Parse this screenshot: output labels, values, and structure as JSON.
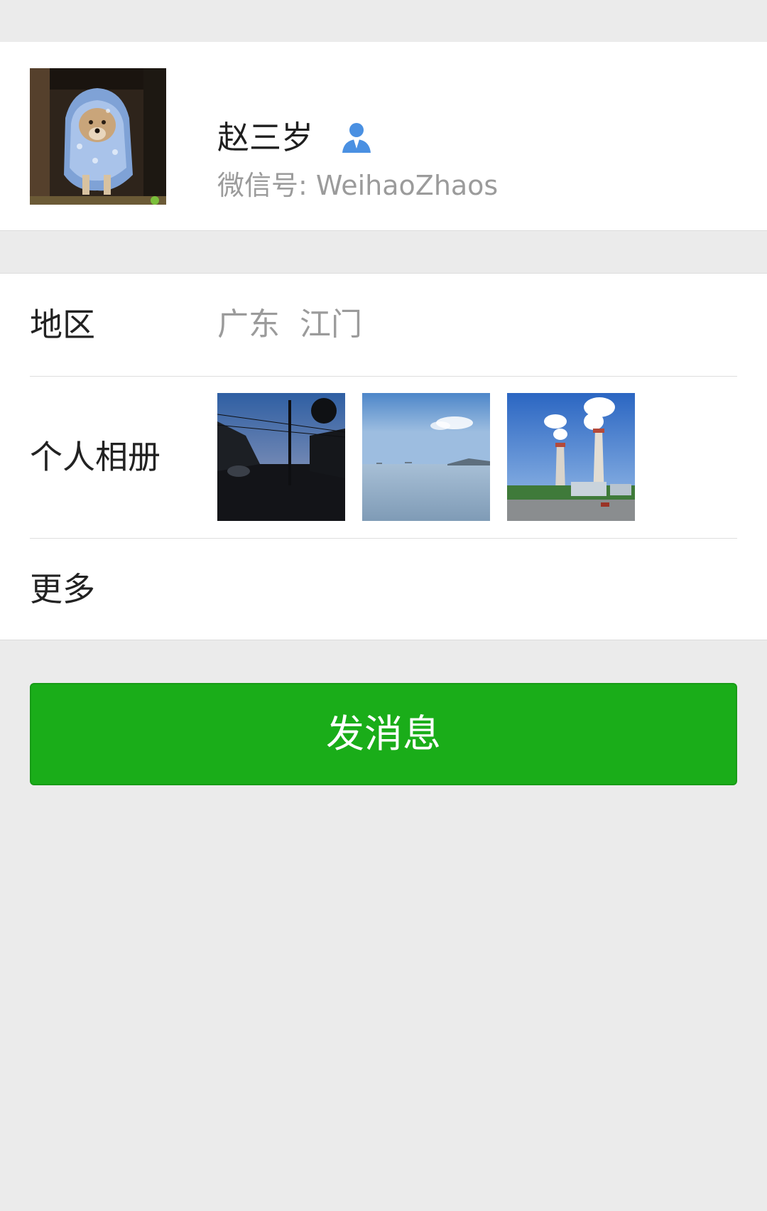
{
  "profile": {
    "name": "赵三岁",
    "wechat_id": "微信号: WeihaoZhaos"
  },
  "info": {
    "region_label": "地区",
    "region_value": "广东  江门",
    "album_label": "个人相册",
    "more_label": "更多"
  },
  "action": {
    "send_message_label": "发消息"
  },
  "colors": {
    "primary_green": "#1aad19",
    "contact_icon_blue": "#4a90e2",
    "secondary_text": "#9b9b9b"
  }
}
